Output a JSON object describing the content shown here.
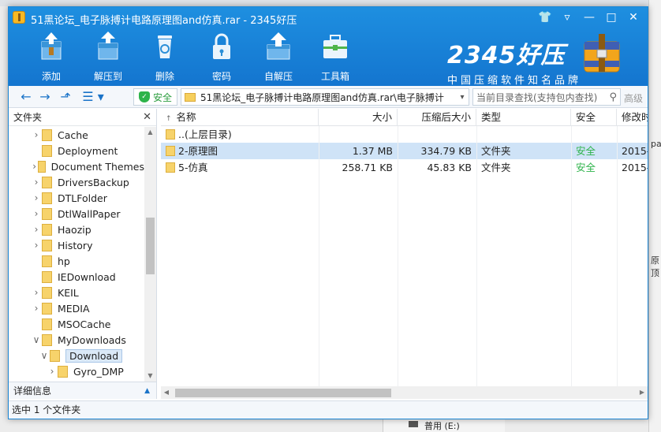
{
  "background": {
    "right_snippets": [
      "pac",
      "原顶"
    ],
    "drive_label": "普用 (E:)"
  },
  "window": {
    "title": "51黑论坛_电子脉搏计电路原理图and仿真.rar - 2345好压",
    "controls": [
      "skin-icon",
      "menu-icon",
      "minimize-icon",
      "maximize-icon",
      "close-icon"
    ]
  },
  "toolbar": {
    "items": [
      {
        "label": "添加",
        "icon": "add-archive-icon"
      },
      {
        "label": "解压到",
        "icon": "extract-to-icon"
      },
      {
        "label": "删除",
        "icon": "delete-icon"
      },
      {
        "label": "密码",
        "icon": "password-lock-icon"
      },
      {
        "label": "自解压",
        "icon": "self-extract-icon"
      },
      {
        "label": "工具箱",
        "icon": "toolbox-icon"
      }
    ]
  },
  "brand": {
    "name": "2345好压",
    "slogan": "中国压缩软件知名品牌"
  },
  "address": {
    "safe_label": "安全",
    "path": "51黑论坛_电子脉搏计电路原理图and仿真.rar\\电子脉搏计",
    "search_placeholder": "当前目录查找(支持包内查找)",
    "advanced_label": "高级"
  },
  "left_panel": {
    "header": "文件夹",
    "tree": [
      {
        "label": "Cache",
        "expandable": true,
        "level": 0
      },
      {
        "label": "Deployment",
        "expandable": false,
        "level": 0
      },
      {
        "label": "Document Themes",
        "expandable": true,
        "level": 0
      },
      {
        "label": "DriversBackup",
        "expandable": true,
        "level": 0
      },
      {
        "label": "DTLFolder",
        "expandable": true,
        "level": 0
      },
      {
        "label": "DtlWallPaper",
        "expandable": true,
        "level": 0
      },
      {
        "label": "Haozip",
        "expandable": true,
        "level": 0
      },
      {
        "label": "History",
        "expandable": true,
        "level": 0
      },
      {
        "label": "hp",
        "expandable": false,
        "level": 0
      },
      {
        "label": "IEDownload",
        "expandable": false,
        "level": 0
      },
      {
        "label": "KEIL",
        "expandable": true,
        "level": 0
      },
      {
        "label": "MEDIA",
        "expandable": true,
        "level": 0
      },
      {
        "label": "MSOCache",
        "expandable": false,
        "level": 0
      },
      {
        "label": "MyDownloads",
        "expandable": true,
        "expanded": true,
        "level": 0
      },
      {
        "label": "Download",
        "expandable": true,
        "expanded": true,
        "level": 1,
        "selected": true
      },
      {
        "label": "Gyro_DMP",
        "expandable": true,
        "level": 2
      }
    ],
    "detail_label": "详细信息"
  },
  "file_list": {
    "columns": {
      "name": "名称",
      "size": "大小",
      "compressed": "压缩后大小",
      "type": "类型",
      "safety": "安全",
      "modified": "修改时"
    },
    "rows": [
      {
        "name": "..(上层目录)",
        "size": "",
        "compressed": "",
        "type": "",
        "safety": "",
        "modified": "",
        "selected": false
      },
      {
        "name": "2-原理图",
        "size": "1.37 MB",
        "compressed": "334.79 KB",
        "type": "文件夹",
        "safety": "安全",
        "modified": "2015-",
        "selected": true
      },
      {
        "name": "5-仿真",
        "size": "258.71 KB",
        "compressed": "45.83 KB",
        "type": "文件夹",
        "safety": "安全",
        "modified": "2015-",
        "selected": false
      }
    ]
  },
  "status": {
    "text": "选中 1 个文件夹"
  },
  "colors": {
    "title_blue": "#1a80d8",
    "safe_green": "#2db34a",
    "selection": "#cfe3f7"
  }
}
